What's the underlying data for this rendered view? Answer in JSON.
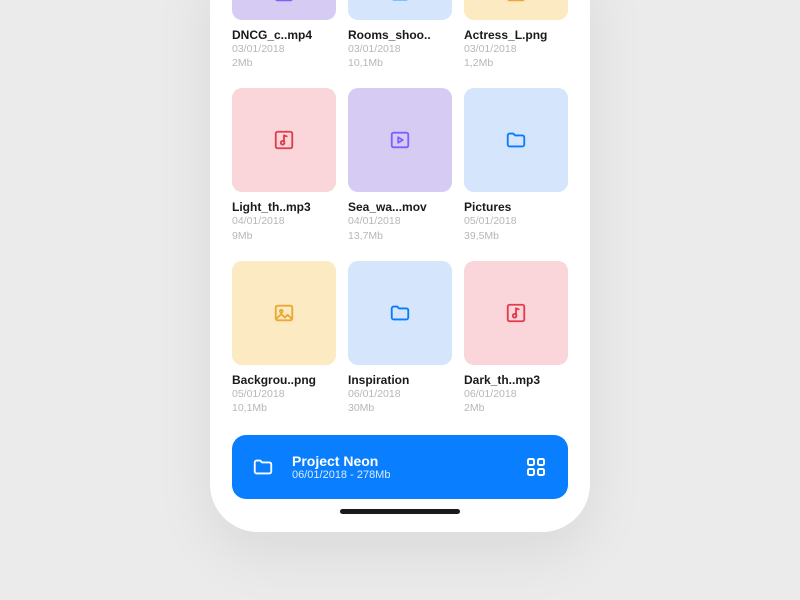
{
  "files": [
    {
      "name": "DNCG_c..mp4",
      "date": "03/01/2018",
      "size": "2Mb",
      "icon": "video",
      "color": "purple"
    },
    {
      "name": "Rooms_shoo..",
      "date": "03/01/2018",
      "size": "10,1Mb",
      "icon": "folder",
      "color": "blue"
    },
    {
      "name": "Actress_L.png",
      "date": "03/01/2018",
      "size": "1,2Mb",
      "icon": "image",
      "color": "yellow"
    },
    {
      "name": "Light_th..mp3",
      "date": "04/01/2018",
      "size": "9Mb",
      "icon": "music",
      "color": "pink"
    },
    {
      "name": "Sea_wa...mov",
      "date": "04/01/2018",
      "size": "13,7Mb",
      "icon": "video",
      "color": "purple"
    },
    {
      "name": "Pictures",
      "date": "05/01/2018",
      "size": "39,5Mb",
      "icon": "folder",
      "color": "blue"
    },
    {
      "name": "Backgrou..png",
      "date": "05/01/2018",
      "size": "10,1Mb",
      "icon": "image",
      "color": "yellow"
    },
    {
      "name": "Inspiration",
      "date": "06/01/2018",
      "size": "30Mb",
      "icon": "folder",
      "color": "blue"
    },
    {
      "name": "Dark_th..mp3",
      "date": "06/01/2018",
      "size": "2Mb",
      "icon": "music",
      "color": "pink"
    }
  ],
  "banner": {
    "title": "Project Neon",
    "subtitle": "06/01/2018 - 278Mb"
  },
  "icon_colors": {
    "video": "#7b61ff",
    "folder": "#0a7bff",
    "image": "#e9a932",
    "music": "#e33b4a"
  }
}
